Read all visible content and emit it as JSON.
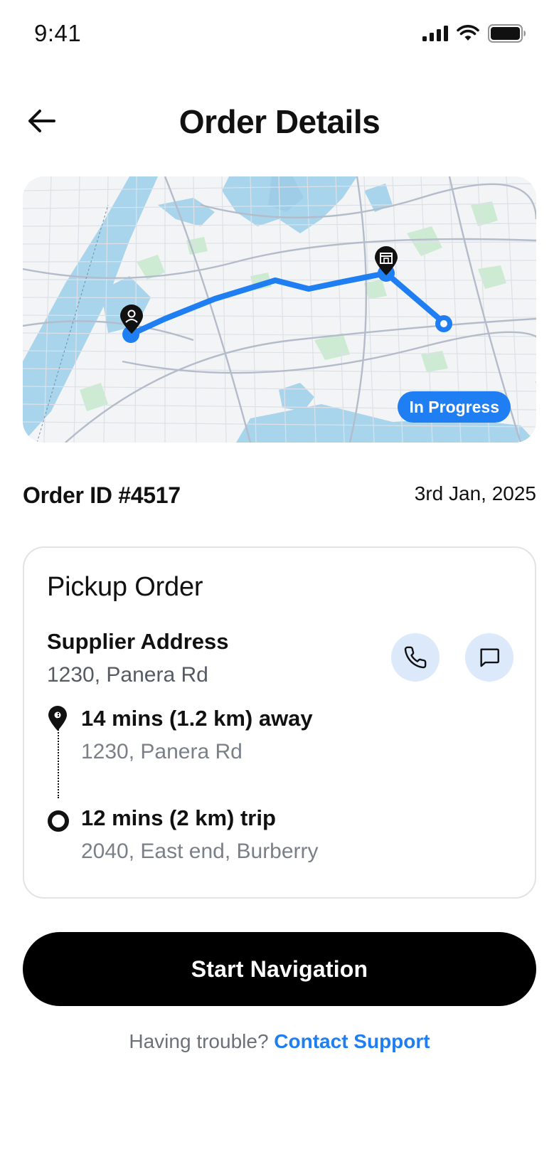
{
  "status_bar": {
    "time": "9:41"
  },
  "header": {
    "title": "Order Details"
  },
  "map": {
    "status_badge": "In Progress"
  },
  "order": {
    "id_label": "Order ID #4517",
    "date": "3rd Jan, 2025"
  },
  "pickup": {
    "title": "Pickup Order",
    "supplier_label": "Supplier Address",
    "supplier_address": "1230, Panera Rd",
    "stops": [
      {
        "main": "14 mins (1.2 km) away",
        "sub": "1230, Panera Rd"
      },
      {
        "main": "12 mins (2 km) trip",
        "sub": "2040, East end, Burberry"
      }
    ]
  },
  "actions": {
    "start_navigation": "Start Navigation"
  },
  "support": {
    "prompt": "Having trouble?",
    "link": "Contact Support"
  },
  "colors": {
    "accent": "#1f7ef2",
    "water": "#a8d4ec",
    "park": "#cdebd2",
    "road": "#b4bccb"
  }
}
